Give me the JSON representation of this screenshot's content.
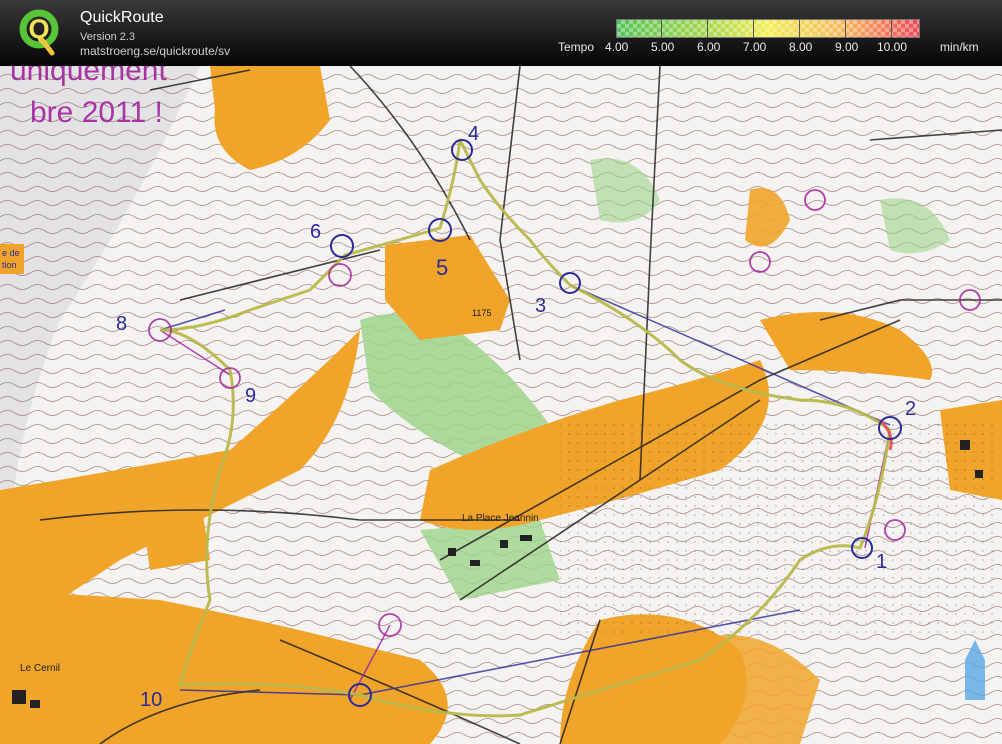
{
  "header": {
    "app_name": "QuickRoute",
    "version": "Version 2.3",
    "url": "matstroeng.se/quickroute/sv",
    "logo_letter": "Q"
  },
  "tempo_scale": {
    "label": "Tempo",
    "ticks": [
      "4.00",
      "5.00",
      "6.00",
      "7.00",
      "8.00",
      "9.00",
      "10.00"
    ],
    "unit": "min/km",
    "colors": [
      "#56c35a",
      "#a7d84f",
      "#f3ee56",
      "#f5b860",
      "#ef4a58"
    ]
  },
  "map": {
    "header_text": "uniquement",
    "date_text": "bre 2011 !",
    "place_name": "La Place Jeannin",
    "place_name_2": "Le Cernil",
    "side_label_1": "e de",
    "side_label_2": "tion",
    "height_label": "1175",
    "control_numbers": [
      "1",
      "2",
      "3",
      "4",
      "5",
      "6",
      "8",
      "9",
      "10"
    ],
    "colors": {
      "paper": "#f4f3f1",
      "open_land": "#f1a42a",
      "vegetation": "#9ed48b",
      "contour": "#6b3a2a",
      "course": "#a4229e",
      "route_track": "#b8b84a",
      "route_line": "#2a2a9a"
    }
  }
}
